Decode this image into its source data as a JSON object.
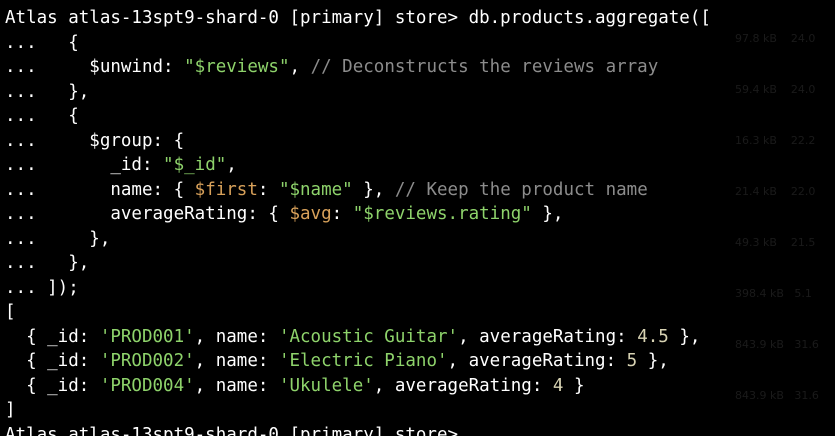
{
  "colors": {
    "background": "#000000",
    "text": "#ffffff",
    "string": "#8ed36b",
    "comment": "#8c8c8c",
    "operator": "#d8a15a",
    "number": "#d8d3b3"
  },
  "terminal": {
    "lines": [
      [
        {
          "t": "Atlas atlas-13spt9-shard-0 [primary] store> db.products.aggregate([",
          "c": "w"
        }
      ],
      [
        {
          "t": "...   {",
          "c": "w"
        }
      ],
      [
        {
          "t": "...     $unwind: ",
          "c": "w"
        },
        {
          "t": "\"$reviews\"",
          "c": "g"
        },
        {
          "t": ", ",
          "c": "w"
        },
        {
          "t": "// Deconstructs the reviews array",
          "c": "c"
        }
      ],
      [
        {
          "t": "...   },",
          "c": "w"
        }
      ],
      [
        {
          "t": "...   {",
          "c": "w"
        }
      ],
      [
        {
          "t": "...     $group: {",
          "c": "w"
        }
      ],
      [
        {
          "t": "...       _id: ",
          "c": "w"
        },
        {
          "t": "\"$_id\"",
          "c": "g"
        },
        {
          "t": ",",
          "c": "w"
        }
      ],
      [
        {
          "t": "...       name: { ",
          "c": "w"
        },
        {
          "t": "$first",
          "c": "o"
        },
        {
          "t": ": ",
          "c": "w"
        },
        {
          "t": "\"$name\"",
          "c": "g"
        },
        {
          "t": " }, ",
          "c": "w"
        },
        {
          "t": "// Keep the product name",
          "c": "c"
        }
      ],
      [
        {
          "t": "...       averageRating: { ",
          "c": "w"
        },
        {
          "t": "$avg",
          "c": "o"
        },
        {
          "t": ": ",
          "c": "w"
        },
        {
          "t": "\"$reviews.rating\"",
          "c": "g"
        },
        {
          "t": " },",
          "c": "w"
        }
      ],
      [
        {
          "t": "...     },",
          "c": "w"
        }
      ],
      [
        {
          "t": "...   },",
          "c": "w"
        }
      ],
      [
        {
          "t": "... ]);",
          "c": "w"
        }
      ],
      [
        {
          "t": "[",
          "c": "w"
        }
      ],
      [
        {
          "t": "  { _id: ",
          "c": "w"
        },
        {
          "t": "'PROD001'",
          "c": "g"
        },
        {
          "t": ", name: ",
          "c": "w"
        },
        {
          "t": "'Acoustic Guitar'",
          "c": "g"
        },
        {
          "t": ", averageRating: ",
          "c": "w"
        },
        {
          "t": "4.5",
          "c": "p"
        },
        {
          "t": " },",
          "c": "w"
        }
      ],
      [
        {
          "t": "  { _id: ",
          "c": "w"
        },
        {
          "t": "'PROD002'",
          "c": "g"
        },
        {
          "t": ", name: ",
          "c": "w"
        },
        {
          "t": "'Electric Piano'",
          "c": "g"
        },
        {
          "t": ", averageRating: ",
          "c": "w"
        },
        {
          "t": "5",
          "c": "p"
        },
        {
          "t": " },",
          "c": "w"
        }
      ],
      [
        {
          "t": "  { _id: ",
          "c": "w"
        },
        {
          "t": "'PROD004'",
          "c": "g"
        },
        {
          "t": ", name: ",
          "c": "w"
        },
        {
          "t": "'Ukulele'",
          "c": "g"
        },
        {
          "t": ", averageRating: ",
          "c": "w"
        },
        {
          "t": "4",
          "c": "p"
        },
        {
          "t": " }",
          "c": "w"
        }
      ],
      [
        {
          "t": "]",
          "c": "w"
        }
      ],
      [
        {
          "t": "Atlas atlas-13spt9-shard-0 [primary] store>",
          "c": "w"
        }
      ]
    ]
  },
  "background_ghost": [
    "97.8 kB    24.0",
    "59.4 kB    24.0",
    "16.3 kB    22.2",
    "21.4 kB    22.0",
    "49.3 kB    21.5",
    "398.4 kB   5.1",
    "843.9 kB   31.6",
    "843.9 kB   31.6"
  ]
}
